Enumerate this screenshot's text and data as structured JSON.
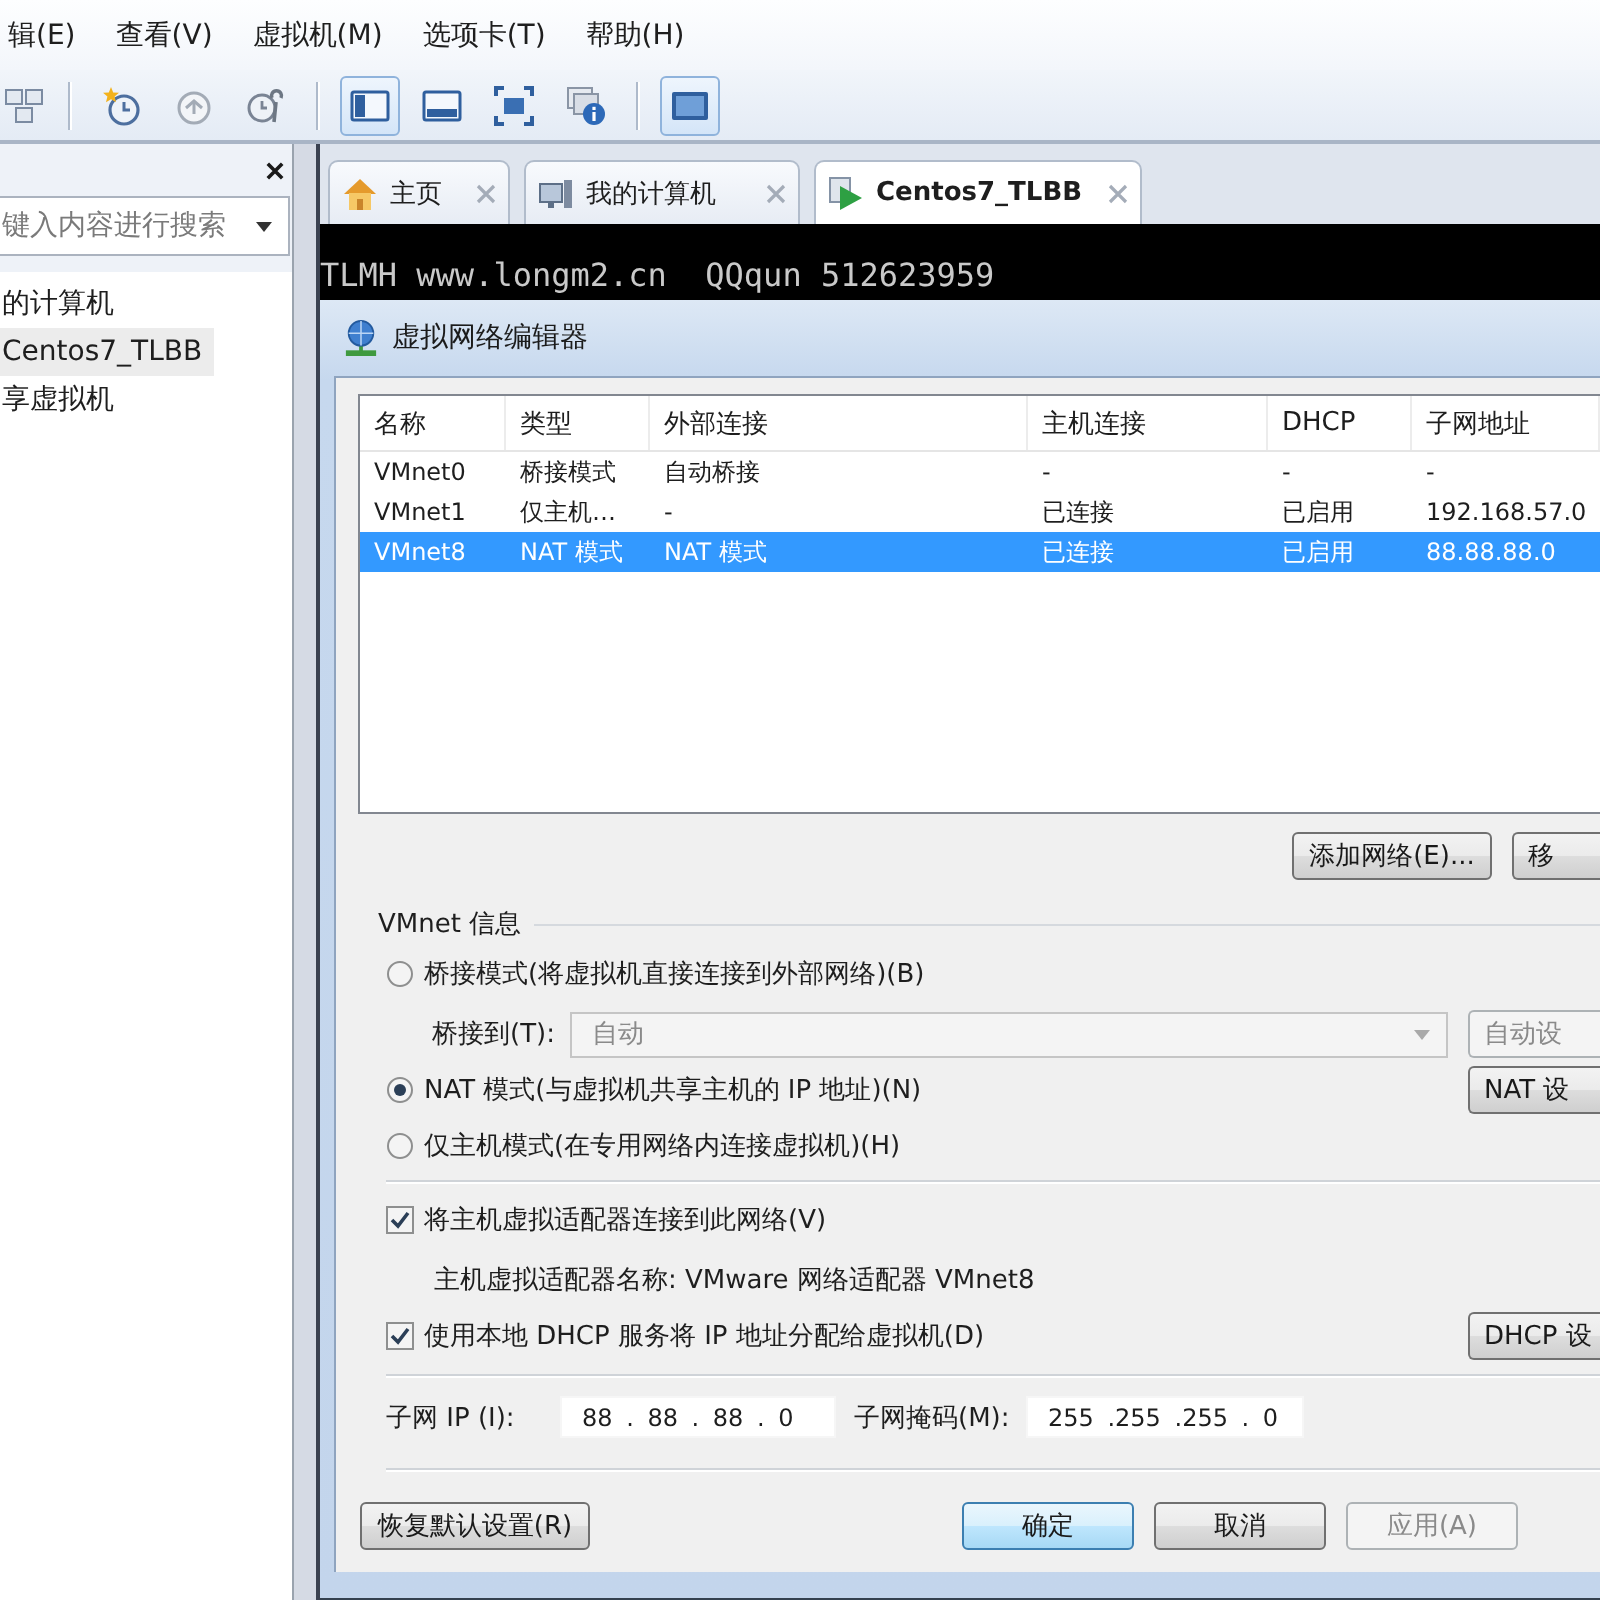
{
  "menu": [
    "辑(E)",
    "查看(V)",
    "虚拟机(M)",
    "选项卡(T)",
    "帮助(H)"
  ],
  "toolbar": {
    "groups": [
      [
        {
          "selected": false
        }
      ],
      [
        {
          "selected": false
        },
        {
          "selected": false
        },
        {
          "selected": false
        }
      ],
      [
        {
          "selected": true
        },
        {
          "selected": false
        },
        {
          "selected": false
        },
        {
          "selected": false
        }
      ],
      [
        {
          "selected": true
        }
      ]
    ]
  },
  "library": {
    "search": {
      "placeholder": "键入内容进行搜索"
    },
    "items": [
      {
        "label": "的计算机",
        "selected": false
      },
      {
        "label": "Centos7_TLBB",
        "selected": true
      },
      {
        "label": "享虚拟机",
        "selected": false
      }
    ]
  },
  "tabs": [
    {
      "label": "主页",
      "selected": false
    },
    {
      "label": "我的计算机",
      "selected": false
    },
    {
      "label": "Centos7_TLBB",
      "selected": true
    }
  ],
  "console": {
    "text": "TLMH www.longm2.cn  QQqun 512623959"
  },
  "dialog": {
    "title": "虚拟网络编辑器",
    "table": {
      "columns": [
        "名称",
        "类型",
        "外部连接",
        "主机连接",
        "DHCP",
        "子网地址"
      ],
      "rows": [
        {
          "cells": [
            "VMnet0",
            "桥接模式",
            "自动桥接",
            "-",
            "-",
            "-"
          ],
          "selected": false
        },
        {
          "cells": [
            "VMnet1",
            "仅主机…",
            "-",
            "已连接",
            "已启用",
            "192.168.57.0"
          ],
          "selected": false
        },
        {
          "cells": [
            "VMnet8",
            "NAT 模式",
            "NAT 模式",
            "已连接",
            "已启用",
            "88.88.88.0"
          ],
          "selected": true
        }
      ]
    },
    "list_buttons": [
      {
        "label": "添加网络(E)...",
        "disabled": false
      },
      {
        "label": "移",
        "disabled": false
      }
    ],
    "vmnet_info": {
      "title": "VMnet 信息",
      "modes": [
        {
          "label": "桥接模式(将虚拟机直接连接到外部网络)(B)",
          "selected": false,
          "bridge_to": {
            "label": "桥接到(T):",
            "value": "自动",
            "disabled": true,
            "button": {
              "label": "自动设",
              "disabled": true
            }
          }
        },
        {
          "label": "NAT 模式(与虚拟机共享主机的 IP 地址)(N)",
          "selected": true,
          "button": {
            "label": "NAT 设",
            "disabled": false
          }
        },
        {
          "label": "仅主机模式(在专用网络内连接虚拟机)(H)",
          "selected": false
        }
      ],
      "connect_adapter": {
        "label": "将主机虚拟适配器连接到此网络(V)",
        "checked": true
      },
      "adapter_name": "主机虚拟适配器名称: VMware 网络适配器 VMnet8",
      "use_dhcp": {
        "label": "使用本地 DHCP 服务将 IP 地址分配给虚拟机(D)",
        "checked": true,
        "button": {
          "label": "DHCP 设",
          "disabled": false
        }
      },
      "subnet_ip": {
        "label": "子网 IP (I):",
        "value": "88 . 88 . 88 . 0"
      },
      "subnet_mask": {
        "label": "子网掩码(M):",
        "value": "255 .255 .255 . 0"
      }
    },
    "footer": {
      "restore": {
        "label": "恢复默认设置(R)",
        "disabled": false
      },
      "buttons": [
        {
          "label": "确定",
          "default": true,
          "disabled": false
        },
        {
          "label": "取消",
          "default": false,
          "disabled": false
        },
        {
          "label": "应用(A)",
          "default": false,
          "disabled": true
        }
      ]
    }
  }
}
